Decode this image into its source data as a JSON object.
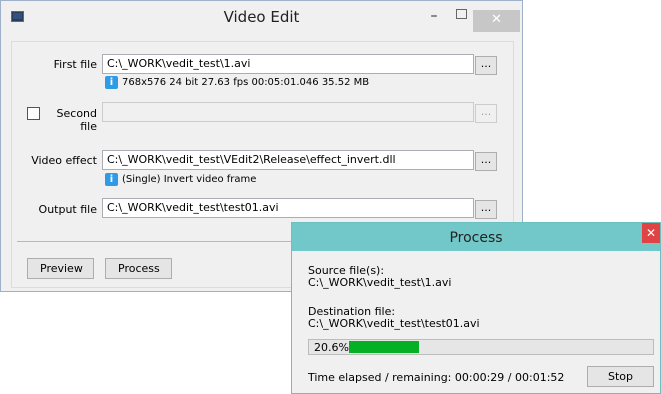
{
  "main_window": {
    "title": "Video Edit",
    "controls": {
      "minimize": "–",
      "close": "✕"
    },
    "first_file": {
      "label": "First file",
      "value": "C:\\_WORK\\vedit_test\\1.avi",
      "info": "768x576  24 bit  27.63 fps  00:05:01.046  35.52 MB"
    },
    "second_file": {
      "label": "Second file",
      "value": "",
      "checked": false
    },
    "video_effect": {
      "label": "Video effect",
      "value": "C:\\_WORK\\vedit_test\\VEdit2\\Release\\effect_invert.dll",
      "info": "(Single) Invert video frame"
    },
    "output_file": {
      "label": "Output file",
      "value": "C:\\_WORK\\vedit_test\\test01.avi"
    },
    "browse_label": "...",
    "preview_label": "Preview",
    "process_label": "Process",
    "info_icon": "i"
  },
  "process_window": {
    "title": "Process",
    "close": "✕",
    "source_label": "Source file(s):",
    "source_value": "C:\\_WORK\\vedit_test\\1.avi",
    "dest_label": "Destination file:",
    "dest_value": "C:\\_WORK\\vedit_test\\test01.avi",
    "progress_text": "20.6%",
    "progress_fraction": 0.206,
    "time_text": "Time elapsed / remaining: 00:00:29 / 00:01:52",
    "stop_label": "Stop",
    "progress_color": "#06b025"
  }
}
